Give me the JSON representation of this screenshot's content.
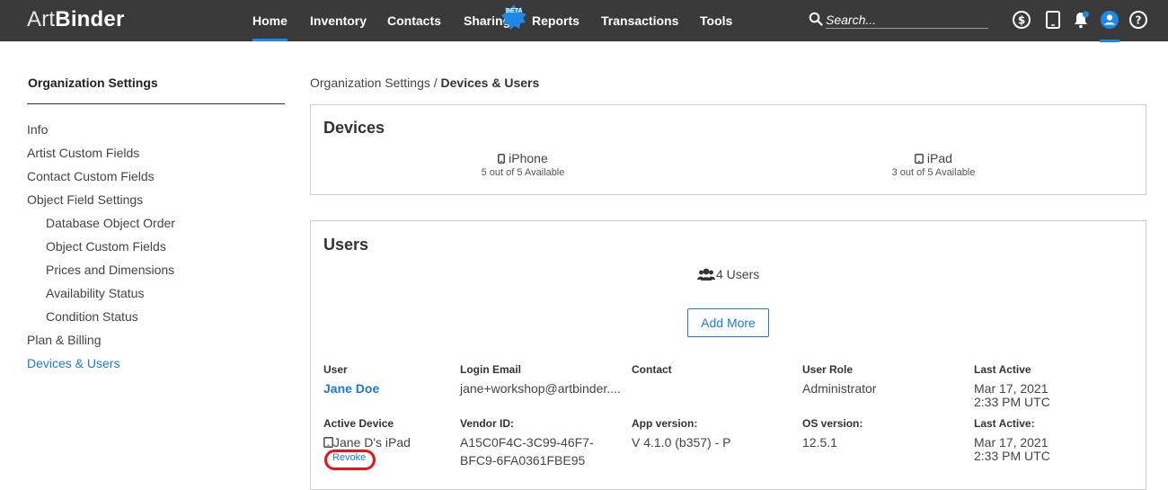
{
  "brand": {
    "part1": "Art",
    "part2": "Binder"
  },
  "nav": {
    "home": "Home",
    "inventory": "Inventory",
    "contacts": "Contacts",
    "sharing": "Sharing",
    "sharing_badge": "BETA",
    "reports": "Reports",
    "transactions": "Transactions",
    "tools": "Tools"
  },
  "search": {
    "placeholder": "Search..."
  },
  "sidebar": {
    "title": "Organization Settings",
    "items": [
      {
        "label": "Info"
      },
      {
        "label": "Artist Custom Fields"
      },
      {
        "label": "Contact Custom Fields"
      },
      {
        "label": "Object Field Settings"
      },
      {
        "label": "Database Object Order"
      },
      {
        "label": "Object Custom Fields"
      },
      {
        "label": "Prices and Dimensions"
      },
      {
        "label": "Availability Status"
      },
      {
        "label": "Condition Status"
      },
      {
        "label": "Plan & Billing"
      },
      {
        "label": "Devices & Users"
      }
    ]
  },
  "breadcrumb": {
    "parent": "Organization Settings",
    "separator": "/",
    "current": "Devices & Users"
  },
  "devices": {
    "title": "Devices",
    "items": [
      {
        "name": "iPhone",
        "available": "5 out of 5 Available"
      },
      {
        "name": "iPad",
        "available": "3 out of 5 Available"
      }
    ]
  },
  "users": {
    "title": "Users",
    "count_label": "4 Users",
    "add_more": "Add More",
    "headers": {
      "user": "User",
      "email": "Login Email",
      "contact": "Contact",
      "role": "User Role",
      "last_active": "Last Active"
    },
    "row": {
      "name": "Jane Doe",
      "email": "jane+workshop@artbinder....",
      "contact": "",
      "role": "Administrator",
      "last_active_date": "Mar 17, 2021",
      "last_active_time": "2:33 PM UTC"
    },
    "device_headers": {
      "device": "Active Device",
      "vendor": "Vendor ID:",
      "app": "App version:",
      "os": "OS version:",
      "last_active": "Last Active:"
    },
    "device_row": {
      "device": "Jane D's iPad",
      "revoke": "Revoke",
      "vendor_1": "A15C0F4C-3C99-46F7-",
      "vendor_2": "BFC9-6FA0361FBE95",
      "app": "V 4.1.0 (b357) - P",
      "os": "12.5.1",
      "last_active_date": "Mar 17, 2021",
      "last_active_time": "2:33 PM UTC"
    }
  },
  "colors": {
    "topbar": "#3a3a3a",
    "accent": "#1e78d2",
    "highlight": "#e2141c"
  }
}
